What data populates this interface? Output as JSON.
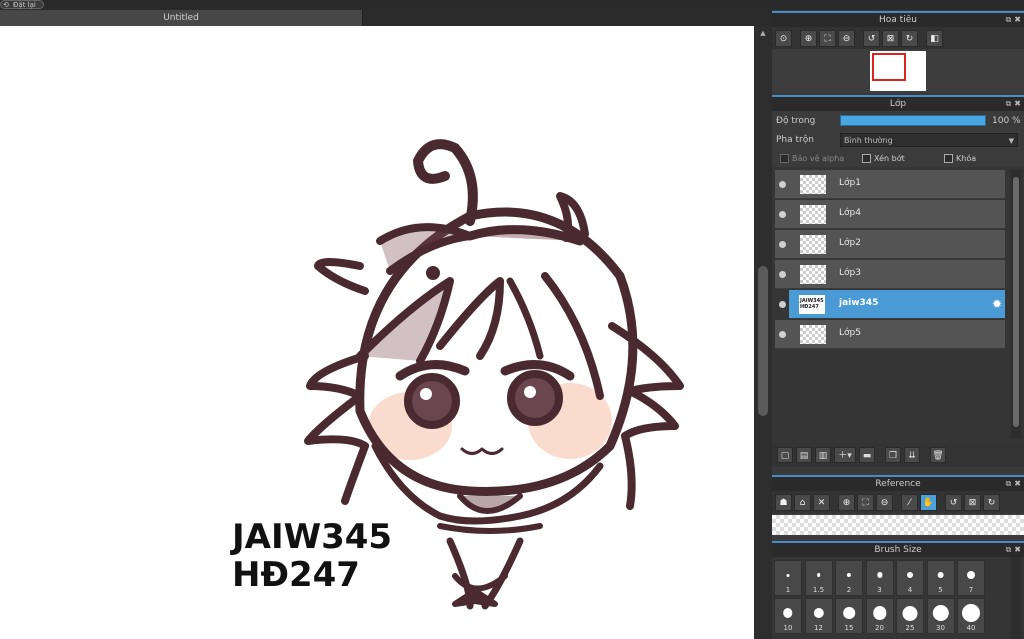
{
  "app": {
    "top_button": "Đặt lại",
    "document_tab": "Untitled"
  },
  "canvas": {
    "watermark_line1": "JAIW345",
    "watermark_line2": "HĐ247"
  },
  "navigator": {
    "title": "Hoa tiêu"
  },
  "layers_panel": {
    "title": "Lớp",
    "opacity_label": "Độ trong",
    "opacity_value": "100 %",
    "opacity_fraction": 1.0,
    "blend_label": "Pha trộn",
    "blend_value": "Bình thường",
    "protect_alpha": "Bảo vệ alpha",
    "clipping": "Xén bớt",
    "lock": "Khóa",
    "layers": [
      {
        "name": "Lớp1"
      },
      {
        "name": "Lớp4"
      },
      {
        "name": "Lớp2"
      },
      {
        "name": "Lớp3"
      },
      {
        "name": "jaiw345",
        "thumb_line1": "JAIW345",
        "thumb_line2": "HĐ247",
        "selected": true
      },
      {
        "name": "Lớp5"
      }
    ]
  },
  "reference": {
    "title": "Reference"
  },
  "brush_size": {
    "title": "Brush Size",
    "sizes": [
      "1",
      "1.5",
      "2",
      "3",
      "4",
      "5",
      "7",
      "10",
      "12",
      "15",
      "20",
      "25",
      "30",
      "40"
    ]
  },
  "colors": {
    "accent": "#4a9ad6",
    "ink": "#4a2a30",
    "blush": "#f6c6b0"
  }
}
